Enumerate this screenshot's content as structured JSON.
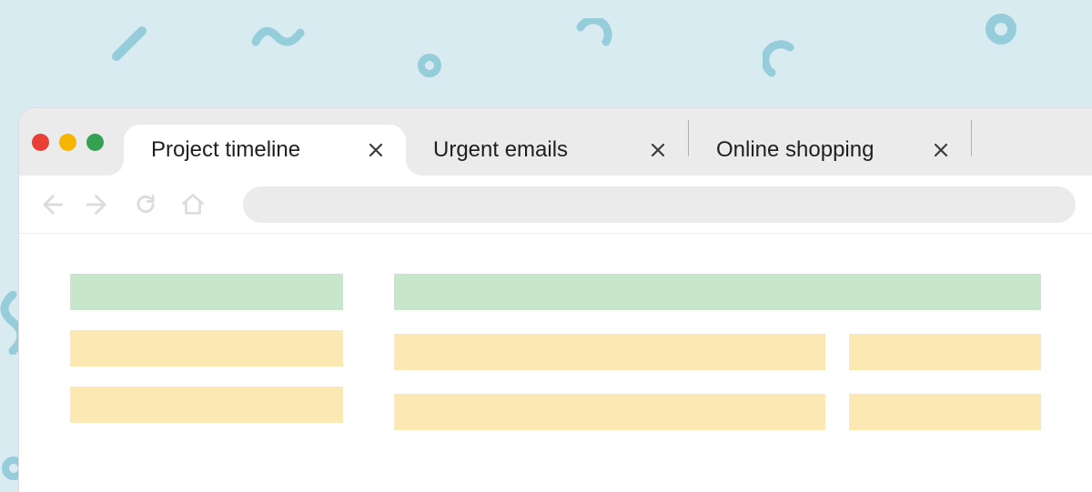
{
  "tabs": [
    {
      "label": "Project timeline",
      "active": true
    },
    {
      "label": "Urgent emails",
      "active": false
    },
    {
      "label": "Online shopping",
      "active": false
    }
  ],
  "colors": {
    "traffic_red": "#e84035",
    "traffic_yellow": "#f6b600",
    "traffic_green": "#35a152",
    "block_green": "#c8e6cb",
    "block_yellow": "#fce8b2",
    "background": "#d7ebf0"
  }
}
